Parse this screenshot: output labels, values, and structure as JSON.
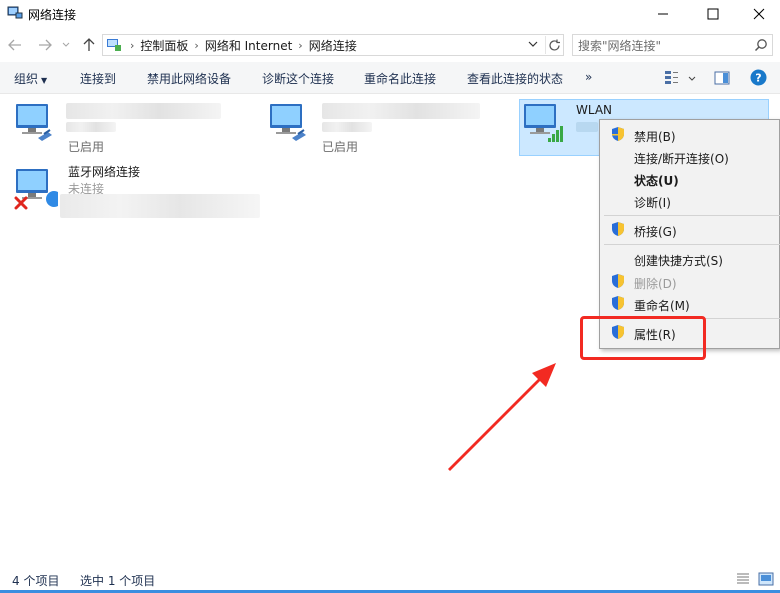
{
  "window": {
    "title": "网络连接"
  },
  "address": {
    "crumbs": [
      "控制面板",
      "网络和 Internet",
      "网络连接"
    ],
    "search_placeholder": "搜索\"网络连接\""
  },
  "commands": [
    {
      "label": "组织",
      "has_arrow": true
    },
    {
      "label": "连接到"
    },
    {
      "label": "禁用此网络设备"
    },
    {
      "label": "诊断这个连接"
    },
    {
      "label": "重命名此连接"
    },
    {
      "label": "查看此连接的状态"
    },
    {
      "label": "»"
    }
  ],
  "items": [
    {
      "name": "",
      "status": "已启用",
      "icon": "ethernet-icon"
    },
    {
      "name": "",
      "status": "已启用",
      "icon": "ethernet-icon"
    },
    {
      "name": "WLAN",
      "status": "",
      "icon": "wifi-icon",
      "selected": true
    },
    {
      "name": "蓝牙网络连接",
      "status": "未连接",
      "icon": "bluetooth-network-icon",
      "disconnected": true
    }
  ],
  "context_menu": {
    "items": [
      {
        "label": "禁用(B)",
        "shield": true
      },
      {
        "label": "连接/断开连接(O)"
      },
      {
        "label": "状态(U)",
        "bold": true
      },
      {
        "label": "诊断(I)"
      },
      {
        "label": "桥接(G)",
        "shield": true
      },
      {
        "label": "创建快捷方式(S)"
      },
      {
        "label": "删除(D)",
        "shield": true,
        "disabled": true
      },
      {
        "label": "重命名(M)",
        "shield": true
      },
      {
        "label": "属性(R)",
        "shield": true,
        "highlighted": true
      }
    ]
  },
  "status": {
    "item_count": "4 个项目",
    "selected_count": "选中 1 个项目"
  },
  "colors": {
    "accent": "#0078d7",
    "selection": "#cce8ff",
    "annotation": "#f22a22"
  }
}
